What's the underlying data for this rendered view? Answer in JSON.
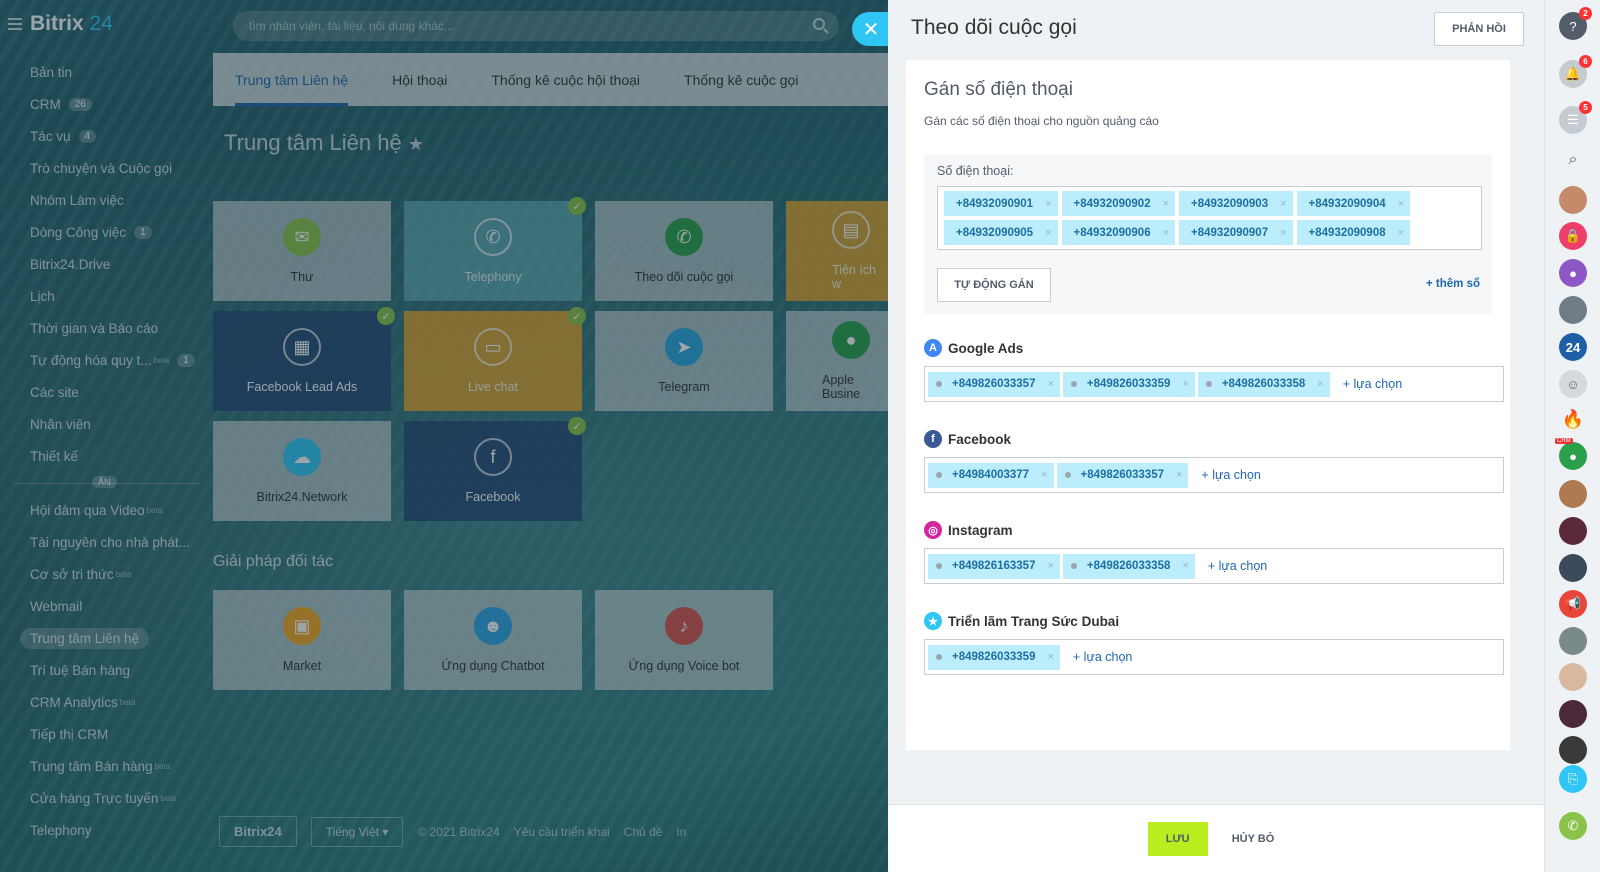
{
  "app": {
    "logo_name": "Bitrix",
    "logo_number": "24",
    "search_placeholder": "tìm nhân viên, tài liệu, nội dung khác..."
  },
  "left_menu": [
    {
      "label": "Bản tin"
    },
    {
      "label": "CRM",
      "count": "26"
    },
    {
      "label": "Tác vụ",
      "count": "4"
    },
    {
      "label": "Trò chuyện và Cuộc gọi"
    },
    {
      "label": "Nhóm Làm việc"
    },
    {
      "label": "Dòng Công việc",
      "count": "1"
    },
    {
      "label": "Bitrix24.Drive"
    },
    {
      "label": "Lịch"
    },
    {
      "label": "Thời gian và Báo cáo"
    },
    {
      "label": "Tự động hóa quy t...",
      "beta": "beta",
      "count": "1"
    },
    {
      "label": "Các site"
    },
    {
      "label": "Nhân viên"
    },
    {
      "label": "Thiết kế"
    }
  ],
  "left_menu_hidden_label": "ẨN",
  "left_menu_hidden": [
    {
      "label": "Hội đàm qua Video",
      "beta": "beta"
    },
    {
      "label": "Tài nguyên cho nhà phát..."
    },
    {
      "label": "Cơ sở tri thức",
      "beta": "beta"
    },
    {
      "label": "Webmail"
    },
    {
      "label": "Trung tâm Liên hệ",
      "active": true
    },
    {
      "label": "Trí tuệ Bán hàng"
    },
    {
      "label": "CRM Analytics",
      "beta": "beta"
    },
    {
      "label": "Tiếp thị CRM"
    },
    {
      "label": "Trung tâm Bán hàng",
      "beta": "beta"
    },
    {
      "label": "Cửa hàng Trực tuyến",
      "beta": "beta"
    },
    {
      "label": "Telephony"
    }
  ],
  "tabs": [
    "Trung tâm Liên hệ",
    "Hội thoại",
    "Thống kê cuộc hội thoại",
    "Thống kê cuộc gọi"
  ],
  "page_title": "Trung tâm Liên hệ",
  "tiles": [
    {
      "label": "Thư",
      "icon": "mail-icon"
    },
    {
      "label": "Telephony",
      "icon": "phone-icon"
    },
    {
      "label": "Theo dõi cuộc gọi",
      "icon": "call-tracking-icon"
    },
    {
      "label": "Tiện ích w",
      "icon": "widget-icon"
    },
    {
      "label": "Facebook Lead Ads",
      "icon": "lead-ads-icon"
    },
    {
      "label": "Live chat",
      "icon": "chat-icon"
    },
    {
      "label": "Telegram",
      "icon": "telegram-icon"
    },
    {
      "label": "Apple Busine",
      "icon": "apple-business-icon"
    },
    {
      "label": "Bitrix24.Network",
      "icon": "cloud-icon"
    },
    {
      "label": "Facebook",
      "icon": "facebook-icon"
    }
  ],
  "partner_section_title": "Giải pháp đối tác",
  "partner_tiles": [
    {
      "label": "Market",
      "icon": "box-icon"
    },
    {
      "label": "Ứng dụng Chatbot",
      "icon": "bot-icon"
    },
    {
      "label": "Ứng dụng Voice bot",
      "icon": "mic-icon"
    }
  ],
  "footer": {
    "logo": "Bitrix24",
    "language": "Tiếng Việt",
    "copyright": "© 2021 Bitrix24",
    "link1": "Yêu cầu triển khai",
    "link2": "Chủ đề",
    "link3": "In"
  },
  "slider": {
    "title": "Theo dõi cuộc gọi",
    "feedback_label": "PHẢN HỒI",
    "card_title": "Gán số điện thoại",
    "card_subtitle": "Gán các số điện thoại cho nguồn quảng cáo",
    "phone_label": "Số điện thoại:",
    "phones": [
      "+84932090901",
      "+84932090902",
      "+84932090903",
      "+84932090904",
      "+84932090905",
      "+84932090906",
      "+84932090907",
      "+84932090908"
    ],
    "auto_assign_label": "TỰ ĐỘNG GÁN",
    "add_number_label": "+ thêm số",
    "add_option_label": "+ lựa chọn",
    "sources": [
      {
        "name": "Google Ads",
        "icon": "google-ads-icon",
        "color": "#4285f4",
        "numbers": [
          "+849826033357",
          "+849826033359",
          "+849826033358"
        ]
      },
      {
        "name": "Facebook",
        "icon": "facebook-icon",
        "color": "#3b5998",
        "numbers": [
          "+84984003377",
          "+849826033357"
        ]
      },
      {
        "name": "Instagram",
        "icon": "instagram-icon",
        "color": "#d6249f",
        "numbers": [
          "+849826163357",
          "+849826033358"
        ]
      },
      {
        "name": "Triển lãm Trang Sức Dubai",
        "icon": "star-icon",
        "color": "#2fc6f6",
        "numbers": [
          "+849826033359"
        ]
      }
    ],
    "save_label": "LƯU",
    "cancel_label": "HỦY BỎ"
  },
  "right_bar": {
    "help_badge": "2",
    "notifications_badge": "6",
    "chat_badge": "5",
    "crm_tag": "CRM"
  },
  "colors": {
    "accent": "#2fc6f6",
    "chip_bg": "#bcedfc",
    "save_green": "#bbed21",
    "link_blue": "#2067b0"
  }
}
